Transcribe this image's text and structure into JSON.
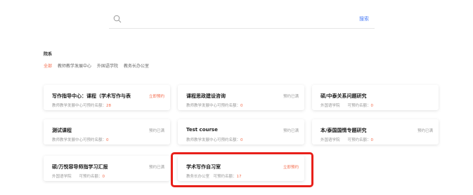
{
  "search": {
    "placeholder": "",
    "button_label": "搜索",
    "icon": "search-icon"
  },
  "filter": {
    "title": "院系",
    "options": [
      {
        "label": "全部",
        "active": true
      },
      {
        "label": "教师教学发展中心",
        "active": false
      },
      {
        "label": "外国语学院",
        "active": false
      },
      {
        "label": "教务长办公室",
        "active": false
      }
    ]
  },
  "cards": [
    {
      "title": "写作指导中心：课程（学术写作与表",
      "meta": "教师教学发展中心可预约名额：",
      "count": "28",
      "action": "立即预约",
      "available": true
    },
    {
      "title": "课程思政建设咨询",
      "meta": "教师教学发展中心可预约名额：",
      "count": "0",
      "action": "预约已满",
      "available": false
    },
    {
      "title": "硕/中泰关系问题研究",
      "meta": "外国语学院　　可预约名额：",
      "count": "0",
      "action": "预约已满",
      "available": false
    },
    {
      "title": "测试课程",
      "meta": "教师教学发展中心可预约名额：",
      "count": "0",
      "action": "预约已满",
      "available": false
    },
    {
      "title": "Test course",
      "meta": "教师教学发展中心可预约名额：",
      "count": "0",
      "action": "预约已满",
      "available": false
    },
    {
      "title": "本/泰国国情专题研究",
      "meta": "外国语学院　　可预约名额：",
      "count": "0",
      "action": "预约已满",
      "available": false
    },
    {
      "title": "硕/万悦容导师指学习汇报",
      "meta": "外国语学院　　可预约名额：",
      "count": "0",
      "action": "预约已满",
      "available": false
    },
    {
      "title": "学术写作自习室",
      "meta": "教务长办公室　可预约名额：",
      "count": "17",
      "action": "立即预约",
      "available": true
    }
  ],
  "colors": {
    "accent": "#f46b4b",
    "link": "#4d7ef7",
    "highlight": "#e8201a"
  }
}
